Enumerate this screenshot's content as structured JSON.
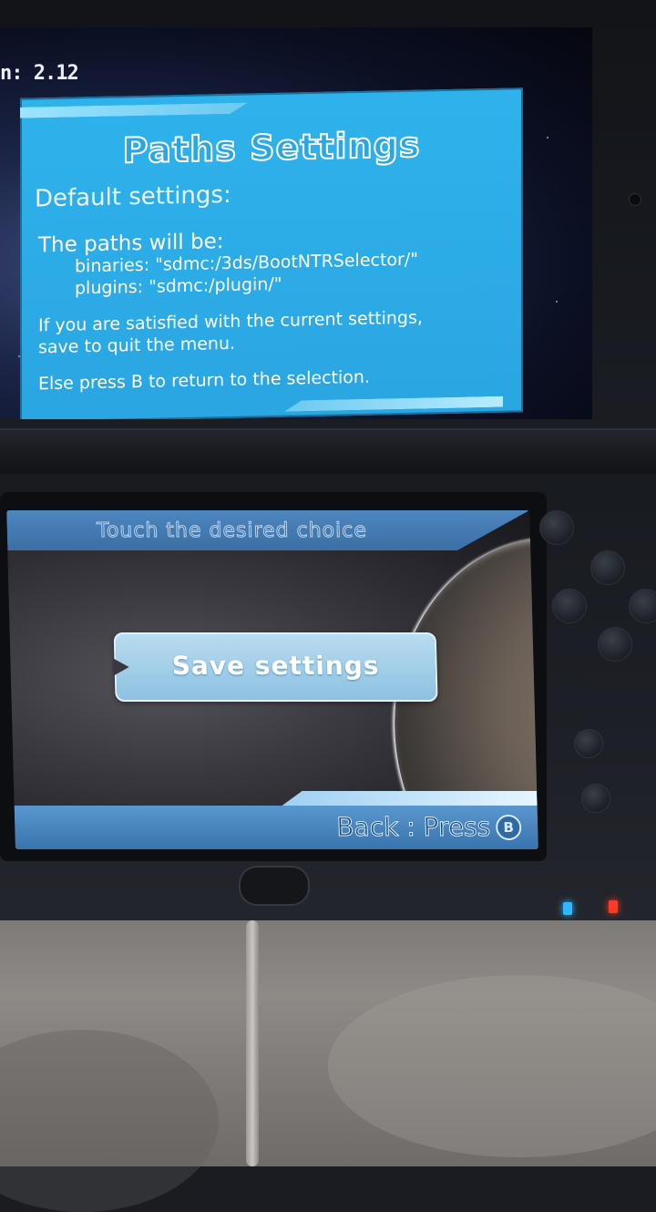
{
  "top_screen": {
    "version": "n: 2.12",
    "dialog": {
      "title": "Paths Settings",
      "subtitle": "Default settings:",
      "lines": [
        "The paths will be:",
        "binaries: \"sdmc:/3ds/BootNTRSelector/\"",
        "plugins:  \"sdmc:/plugin/\"",
        "If you are satisfied with the current settings,",
        "save to quit the menu.",
        "Else press B to return to the selection."
      ]
    }
  },
  "bottom_screen": {
    "header": "Touch the desired choice",
    "save_button": "Save settings",
    "back": {
      "label": "Back : Press",
      "button_glyph": "B",
      "icon": "b-button-icon"
    }
  },
  "device": {
    "led_colors": {
      "blue": "#2fb8ff",
      "red": "#ff3a24"
    },
    "dialog_color": "#2aa6e2",
    "button_color": "#8dc1e1"
  }
}
